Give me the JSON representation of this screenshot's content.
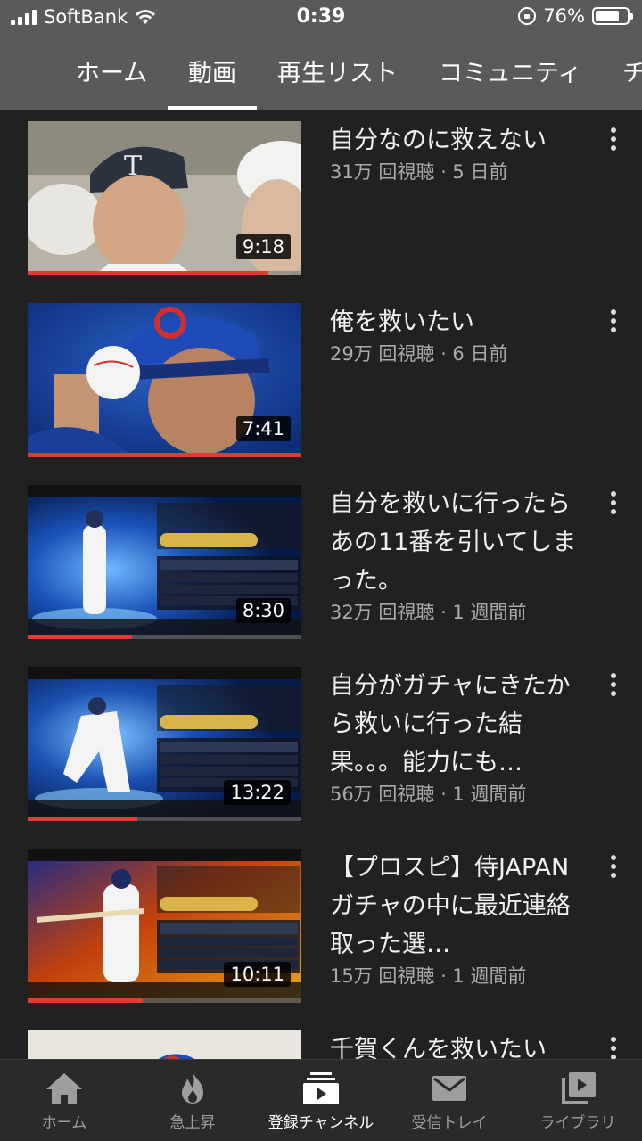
{
  "status": {
    "carrier": "SoftBank",
    "time": "0:39",
    "battery": "76%",
    "battery_level": 0.76
  },
  "tabs": [
    {
      "label": "ホーム",
      "selected": false
    },
    {
      "label": "動画",
      "selected": true
    },
    {
      "label": "再生リスト",
      "selected": false
    },
    {
      "label": "コミュニティ",
      "selected": false
    },
    {
      "label": "チ",
      "selected": false
    }
  ],
  "videos": [
    {
      "title": "自分なのに救えない",
      "meta": "31万 回視聴 · 5 日前",
      "duration": "9:18",
      "watched": 0.88,
      "thumb_icon": "crying-baseball-player-thumbnail"
    },
    {
      "title": "俺を救いたい",
      "meta": "29万 回視聴 · 6 日前",
      "duration": "7:41",
      "watched": 1.0,
      "thumb_icon": "cubs-pitcher-thumbnail"
    },
    {
      "title": "自分を救いに行ったらあの11番を引いてしまった。",
      "meta": "32万 回視聴 · 1 週間前",
      "duration": "8:30",
      "watched": 0.38,
      "thumb_icon": "game-card-thumbnail"
    },
    {
      "title": "自分がガチャにきたから救いに行った結果。。。能力にも…",
      "meta": "56万 回視聴 · 1 週間前",
      "duration": "13:22",
      "watched": 0.4,
      "thumb_icon": "game-card-thumbnail"
    },
    {
      "title": "【プロスピ】侍JAPANガチャの中に最近連絡取った選…",
      "meta": "15万 回視聴 · 1 週間前",
      "duration": "10:11",
      "watched": 0.42,
      "thumb_icon": "game-card-thumbnail"
    },
    {
      "title": "千賀くんを救いたい",
      "meta": "",
      "duration": "",
      "watched": 0,
      "thumb_icon": "cubs-cap-thumbnail"
    }
  ],
  "bottom_nav": [
    {
      "label": "ホーム",
      "icon": "home-icon",
      "active": false
    },
    {
      "label": "急上昇",
      "icon": "flame-icon",
      "active": false
    },
    {
      "label": "登録チャンネル",
      "icon": "subscriptions-icon",
      "active": true
    },
    {
      "label": "受信トレイ",
      "icon": "inbox-icon",
      "active": false
    },
    {
      "label": "ライブラリ",
      "icon": "library-icon",
      "active": false
    }
  ]
}
